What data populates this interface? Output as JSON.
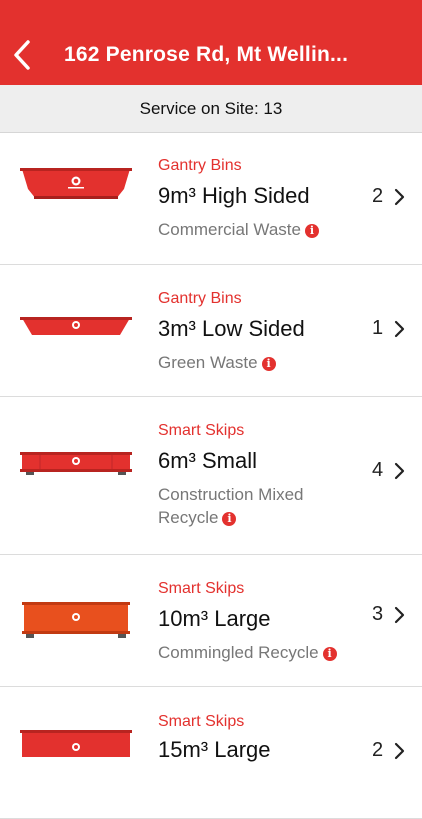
{
  "header": {
    "title": "162 Penrose Rd, Mt Wellin...",
    "back_icon": "chevron-left-icon",
    "color": "#e3312e"
  },
  "subbar": {
    "text": "Service on Site: 13"
  },
  "items": [
    {
      "category": "Gantry Bins",
      "name": "9m³ High Sided",
      "waste": "Commercial Waste",
      "count": "2",
      "bin_color": "#e3312e"
    },
    {
      "category": "Gantry Bins",
      "name": "3m³ Low Sided",
      "waste": "Green Waste",
      "count": "1",
      "bin_color": "#e3312e"
    },
    {
      "category": "Smart Skips",
      "name": "6m³ Small",
      "waste": "Construction Mixed Recycle",
      "count": "4",
      "bin_color": "#e3312e"
    },
    {
      "category": "Smart Skips",
      "name": "10m³ Large",
      "waste": "Commingled Recycle",
      "count": "3",
      "bin_color": "#e8501e"
    },
    {
      "category": "Smart Skips",
      "name": "15m³ Large",
      "waste": "",
      "count": "2",
      "bin_color": "#e3312e"
    }
  ]
}
